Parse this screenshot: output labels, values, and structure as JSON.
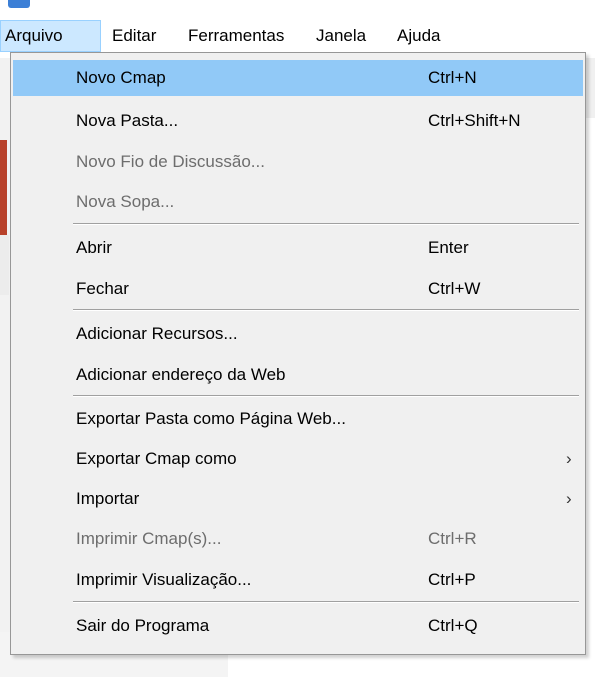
{
  "menubar": {
    "items": [
      {
        "label": "Arquivo",
        "active": true
      },
      {
        "label": "Editar"
      },
      {
        "label": "Ferramentas"
      },
      {
        "label": "Janela"
      },
      {
        "label": "Ajuda"
      }
    ]
  },
  "menu": {
    "highlight_color": "#91c9f7",
    "groups": [
      [
        {
          "label": "Novo Cmap",
          "shortcut": "Ctrl+N",
          "highlighted": true
        },
        {
          "label": "Nova Pasta...",
          "shortcut": "Ctrl+Shift+N"
        },
        {
          "label": "Novo Fio de Discussão...",
          "disabled": true
        },
        {
          "label": "Nova Sopa...",
          "disabled": true
        }
      ],
      [
        {
          "label": "Abrir",
          "shortcut": "Enter"
        },
        {
          "label": "Fechar",
          "shortcut": "Ctrl+W"
        }
      ],
      [
        {
          "label": "Adicionar Recursos..."
        },
        {
          "label": "Adicionar endereço da Web"
        }
      ],
      [
        {
          "label": "Exportar Pasta como Página Web..."
        },
        {
          "label": "Exportar Cmap como",
          "submenu": true,
          "submenu_icon": "chevron-right-icon"
        },
        {
          "label": "Importar",
          "submenu": true,
          "submenu_icon": "chevron-right-icon"
        },
        {
          "label": "Imprimir Cmap(s)...",
          "shortcut": "Ctrl+R",
          "disabled": true
        },
        {
          "label": "Imprimir Visualização...",
          "shortcut": "Ctrl+P"
        }
      ],
      [
        {
          "label": "Sair do Programa",
          "shortcut": "Ctrl+Q"
        }
      ]
    ]
  }
}
